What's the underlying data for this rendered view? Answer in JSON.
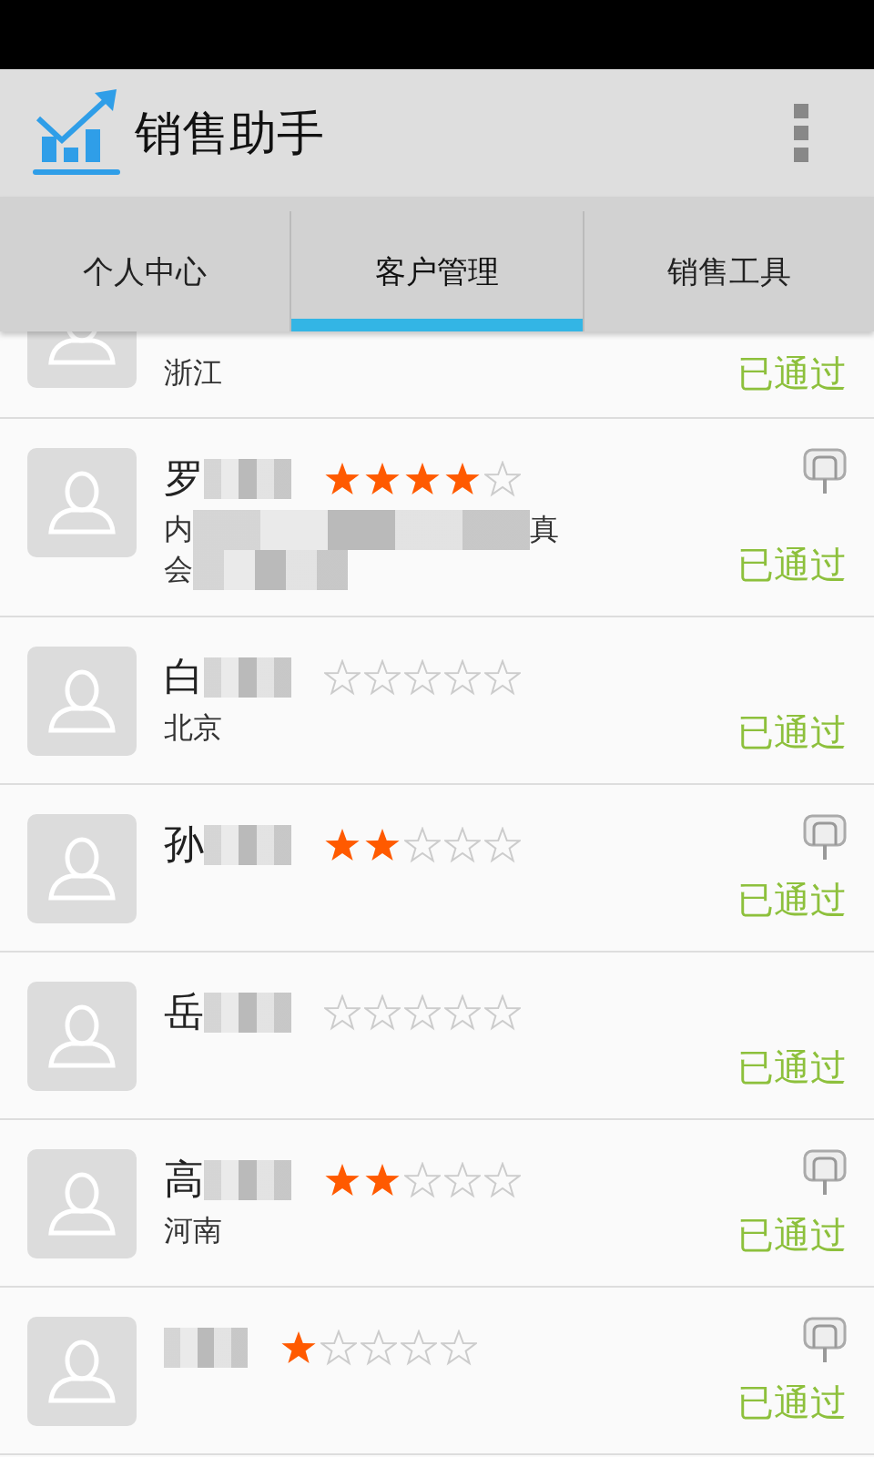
{
  "app_bar": {
    "title": "销售助手"
  },
  "tabs": [
    {
      "label": "个人中心",
      "selected": false
    },
    {
      "label": "客户管理",
      "selected": true
    },
    {
      "label": "销售工具",
      "selected": false
    }
  ],
  "partial_row": {
    "address": [
      "浙江"
    ],
    "status": "已通过"
  },
  "rows": [
    {
      "name": "罗",
      "stars": 4,
      "address": [
        "内",
        "真"
      ],
      "address_2": [
        "会"
      ],
      "pinned": true,
      "status": "已通过"
    },
    {
      "name": "白",
      "stars": 0,
      "address": [
        "北京"
      ],
      "pinned": false,
      "status": "已通过"
    },
    {
      "name": "孙",
      "stars": 2,
      "pinned": true,
      "status": "已通过"
    },
    {
      "name": "岳",
      "stars": 0,
      "pinned": false,
      "status": "已通过"
    },
    {
      "name": "高",
      "stars": 2,
      "address": [
        "河南"
      ],
      "pinned": true,
      "status": "已通过"
    },
    {
      "stars": 1,
      "pinned": true,
      "status": "已通过"
    }
  ]
}
